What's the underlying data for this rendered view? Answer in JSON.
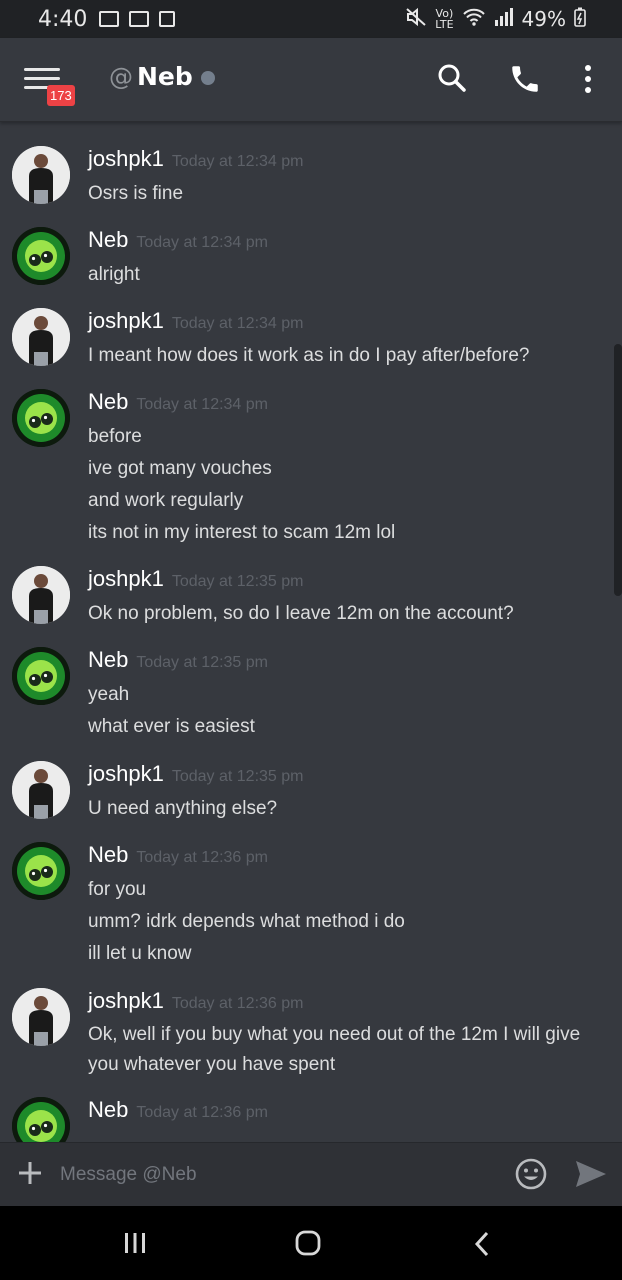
{
  "status_bar": {
    "time": "4:40",
    "battery": "49%",
    "network": "LTE",
    "volte": "Vo)"
  },
  "header": {
    "badge_count": "173",
    "at_symbol": "@",
    "channel_name": "Neb"
  },
  "messages": [
    {
      "user": "joshpk1",
      "time": "Today at 12:34 pm",
      "avatar": "josh",
      "lines": [
        "Osrs is fine"
      ]
    },
    {
      "user": "Neb",
      "time": "Today at 12:34 pm",
      "avatar": "neb",
      "lines": [
        "alright"
      ]
    },
    {
      "user": "joshpk1",
      "time": "Today at 12:34 pm",
      "avatar": "josh",
      "lines": [
        "I meant how does it work as in do I pay after/before?"
      ]
    },
    {
      "user": "Neb",
      "time": "Today at 12:34 pm",
      "avatar": "neb",
      "lines": [
        "before",
        "ive got many vouches",
        "and work regularly",
        "its not in my interest to scam 12m lol"
      ]
    },
    {
      "user": "joshpk1",
      "time": "Today at 12:35 pm",
      "avatar": "josh",
      "lines": [
        "Ok no problem, so do I leave 12m on the account?"
      ]
    },
    {
      "user": "Neb",
      "time": "Today at 12:35 pm",
      "avatar": "neb",
      "lines": [
        "yeah",
        "what ever is easiest"
      ]
    },
    {
      "user": "joshpk1",
      "time": "Today at 12:35 pm",
      "avatar": "josh",
      "lines": [
        "U need anything else?"
      ]
    },
    {
      "user": "Neb",
      "time": "Today at 12:36 pm",
      "avatar": "neb",
      "lines": [
        "for you",
        "umm? idrk depends what method i do",
        "ill let u know"
      ]
    },
    {
      "user": "joshpk1",
      "time": "Today at 12:36 pm",
      "avatar": "josh",
      "lines": [
        "Ok, well if you buy what you need out of the 12m I will give you whatever you have spent"
      ]
    },
    {
      "user": "Neb",
      "time": "Today at 12:36 pm",
      "avatar": "neb",
      "lines": []
    }
  ],
  "composer": {
    "placeholder": "Message @Neb"
  },
  "icons": {
    "menu": "hamburger-icon",
    "search": "search-icon",
    "call": "phone-icon",
    "more": "more-vertical-icon",
    "attach": "plus-icon",
    "emoji": "emoji-icon",
    "send": "send-icon",
    "nav_recents": "recents-icon",
    "nav_home": "home-icon",
    "nav_back": "back-icon"
  },
  "colors": {
    "background": "#36393f",
    "status_offline": "#747f8d",
    "badge": "#ed4245",
    "username": "#ffffff",
    "text": "#dcddde"
  }
}
